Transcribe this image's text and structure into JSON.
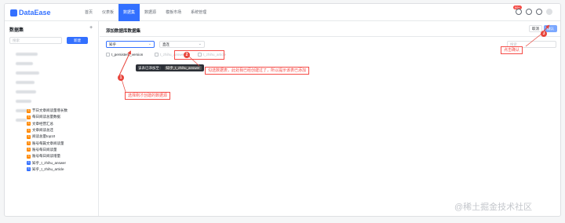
{
  "app": {
    "logo": "DataEase"
  },
  "nav": [
    {
      "label": "首页",
      "active": false
    },
    {
      "label": "仪表板",
      "active": false
    },
    {
      "label": "数据集",
      "active": true
    },
    {
      "label": "数据源",
      "active": false
    },
    {
      "label": "模板市场",
      "active": false
    },
    {
      "label": "系统管理",
      "active": false
    }
  ],
  "notification_badge": "99+",
  "sidebar": {
    "title": "数据集",
    "plus": "+",
    "search_placeholder": "搜索",
    "new_button": "新建",
    "items": [
      {
        "label": "节日文章阅读量增长数",
        "icon": "S"
      },
      {
        "label": "每日阅读总量数据",
        "icon": "S"
      },
      {
        "label": "文章经营汇总",
        "icon": "S"
      },
      {
        "label": "文章阅读总还",
        "icon": "S"
      },
      {
        "label": "阅读总量top10",
        "icon": "S"
      },
      {
        "label": "账号每篇文章阅读量",
        "icon": "S"
      },
      {
        "label": "账号每日阅读量",
        "icon": "S"
      },
      {
        "label": "账号每日阅读增量",
        "icon": "S"
      },
      {
        "label": "知乎_t_zhihu_answer",
        "icon": "S"
      },
      {
        "label": "知乎_t_zhihu_article",
        "icon": "S"
      }
    ]
  },
  "main": {
    "title": "添加数据库数据集",
    "cancel": "取消",
    "confirm": "确认",
    "datasource_select": "知乎",
    "mode_select": "直连",
    "search_placeholder": "搜索",
    "tables": [
      {
        "label": "t_persistent_version",
        "disabled": false
      },
      {
        "label": "t_zhihu_answer",
        "disabled": true
      },
      {
        "label": "t_zhihu_article",
        "disabled": true
      }
    ],
    "tooltip": {
      "prefix": "该表已添加至：",
      "chip": "知乎_t_zhihu_answer"
    }
  },
  "annotations": {
    "a1": {
      "num": "1",
      "text": "选择刚才创建的数据源"
    },
    "a2": {
      "num": "2",
      "text": "勾选数据表，此处我已经创建过了，所以提示该表已添加"
    },
    "a3": {
      "num": "3",
      "text": "点击确认"
    }
  },
  "watermark": "@稀土掘金技术社区",
  "colors": {
    "accent": "#3370ff",
    "annotation": "#f54a45"
  }
}
